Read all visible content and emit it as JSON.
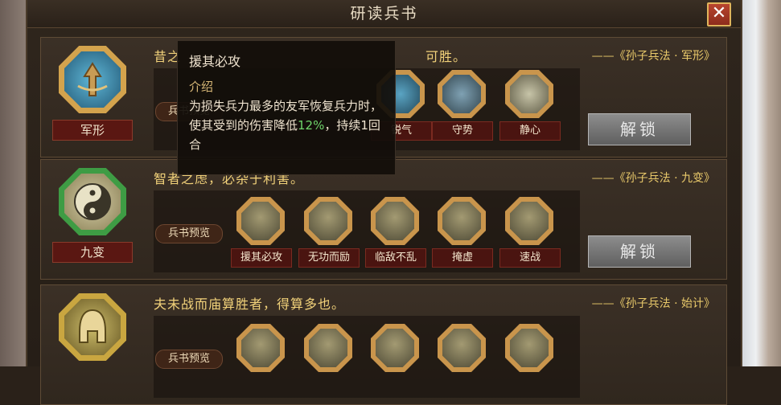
{
  "window": {
    "title": "研读兵书",
    "close_label": "✕"
  },
  "rows": [
    {
      "badge_name": "军形",
      "badge_color": "#3f86a6",
      "quote": "昔之善战者，先为不可胜，以待敌之可胜。",
      "quote_visible": "昔之",
      "quote_tail": "可胜。",
      "source": "——《孙子兵法 · 军形》",
      "preview_label": "兵书预览",
      "skills": [
        "",
        "",
        "锐气",
        "守势",
        "静心"
      ],
      "unlock_label": "解锁"
    },
    {
      "badge_name": "九变",
      "badge_color": "#3f9a48",
      "quote": "智者之虑，必杂于利害。",
      "source": "——《孙子兵法 · 九变》",
      "preview_label": "兵书预览",
      "skills": [
        "援其必攻",
        "无功而励",
        "临敌不乱",
        "掩虚",
        "速战"
      ],
      "unlock_label": "解锁"
    },
    {
      "badge_name": "",
      "badge_color": "#c9a640",
      "quote": "夫未战而庙算胜者，得算多也。",
      "source": "——《孙子兵法 · 始计》",
      "preview_label": "兵书预览",
      "skills": [],
      "unlock_label": ""
    }
  ],
  "tooltip": {
    "title": "援其必攻",
    "section": "介绍",
    "desc_part1": "为损失兵力最多的友军恢复兵力时，使其受到的伤害降低",
    "desc_highlight": "12%",
    "desc_part2": "，持续1回合"
  }
}
